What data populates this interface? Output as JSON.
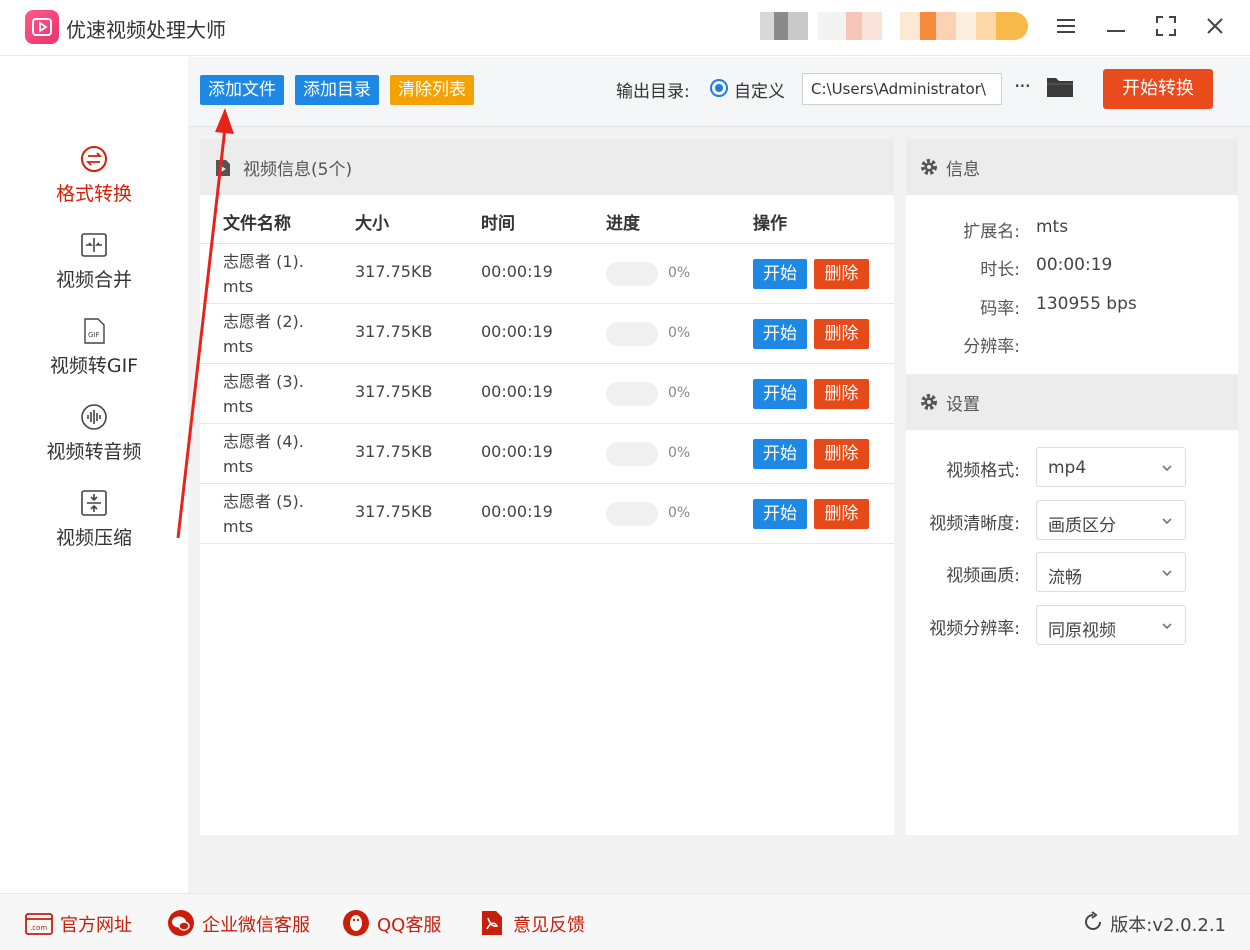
{
  "app": {
    "title": "优速视频处理大师"
  },
  "sidebar": {
    "items": [
      {
        "label": "格式转换",
        "icon": "format-convert-icon",
        "active": true
      },
      {
        "label": "视频合并",
        "icon": "merge-icon",
        "active": false
      },
      {
        "label": "视频转GIF",
        "icon": "gif-icon",
        "active": false
      },
      {
        "label": "视频转音频",
        "icon": "audio-icon",
        "active": false
      },
      {
        "label": "视频压缩",
        "icon": "compress-icon",
        "active": false
      }
    ]
  },
  "toolbar": {
    "add_file": "添加文件",
    "add_dir": "添加目录",
    "clear_list": "清除列表",
    "output_label": "输出目录:",
    "radio_label": "自定义",
    "output_path": "C:\\Users\\Administrator\\",
    "more": "···",
    "start_all": "开始转换"
  },
  "video_list": {
    "title": "视频信息(5个)",
    "columns": [
      "文件名称",
      "大小",
      "时间",
      "进度",
      "操作"
    ],
    "rows": [
      {
        "name": "志愿者 (1).mts",
        "name_line1": "志愿者 (1).",
        "name_line2": "mts",
        "size": "317.75KB",
        "time": "00:00:19",
        "progress": 0,
        "progress_text": "0%"
      },
      {
        "name": "志愿者 (2).mts",
        "name_line1": "志愿者 (2).",
        "name_line2": "mts",
        "size": "317.75KB",
        "time": "00:00:19",
        "progress": 0,
        "progress_text": "0%"
      },
      {
        "name": "志愿者 (3).mts",
        "name_line1": "志愿者 (3).",
        "name_line2": "mts",
        "size": "317.75KB",
        "time": "00:00:19",
        "progress": 0,
        "progress_text": "0%"
      },
      {
        "name": "志愿者 (4).mts",
        "name_line1": "志愿者 (4).",
        "name_line2": "mts",
        "size": "317.75KB",
        "time": "00:00:19",
        "progress": 0,
        "progress_text": "0%"
      },
      {
        "name": "志愿者 (5).mts",
        "name_line1": "志愿者 (5).",
        "name_line2": "mts",
        "size": "317.75KB",
        "time": "00:00:19",
        "progress": 0,
        "progress_text": "0%"
      }
    ],
    "start_label": "开始",
    "delete_label": "删除"
  },
  "info": {
    "title": "信息",
    "fields": [
      {
        "label": "扩展名:",
        "value": "mts"
      },
      {
        "label": "时长:",
        "value": "00:00:19"
      },
      {
        "label": "码率:",
        "value": "130955 bps"
      },
      {
        "label": "分辨率:",
        "value": ""
      }
    ]
  },
  "settings": {
    "title": "设置",
    "fields": [
      {
        "label": "视频格式:",
        "value": "mp4"
      },
      {
        "label": "视频清晰度:",
        "value": "画质区分"
      },
      {
        "label": "视频画质:",
        "value": "流畅"
      },
      {
        "label": "视频分辨率:",
        "value": "同原视频"
      }
    ]
  },
  "footer": {
    "items": [
      {
        "label": "官方网址",
        "icon": "website-icon"
      },
      {
        "label": "企业微信客服",
        "icon": "wechat-service-icon"
      },
      {
        "label": "QQ客服",
        "icon": "qq-icon"
      },
      {
        "label": "意见反馈",
        "icon": "feedback-icon"
      }
    ],
    "version": "版本:v2.0.2.1"
  },
  "colors": {
    "accent_red": "#d81e06",
    "blue_button": "#1e88e5",
    "orange_button": "#f5a100",
    "delete_button": "#e64a19",
    "start_convert": "#ea4b1d"
  }
}
